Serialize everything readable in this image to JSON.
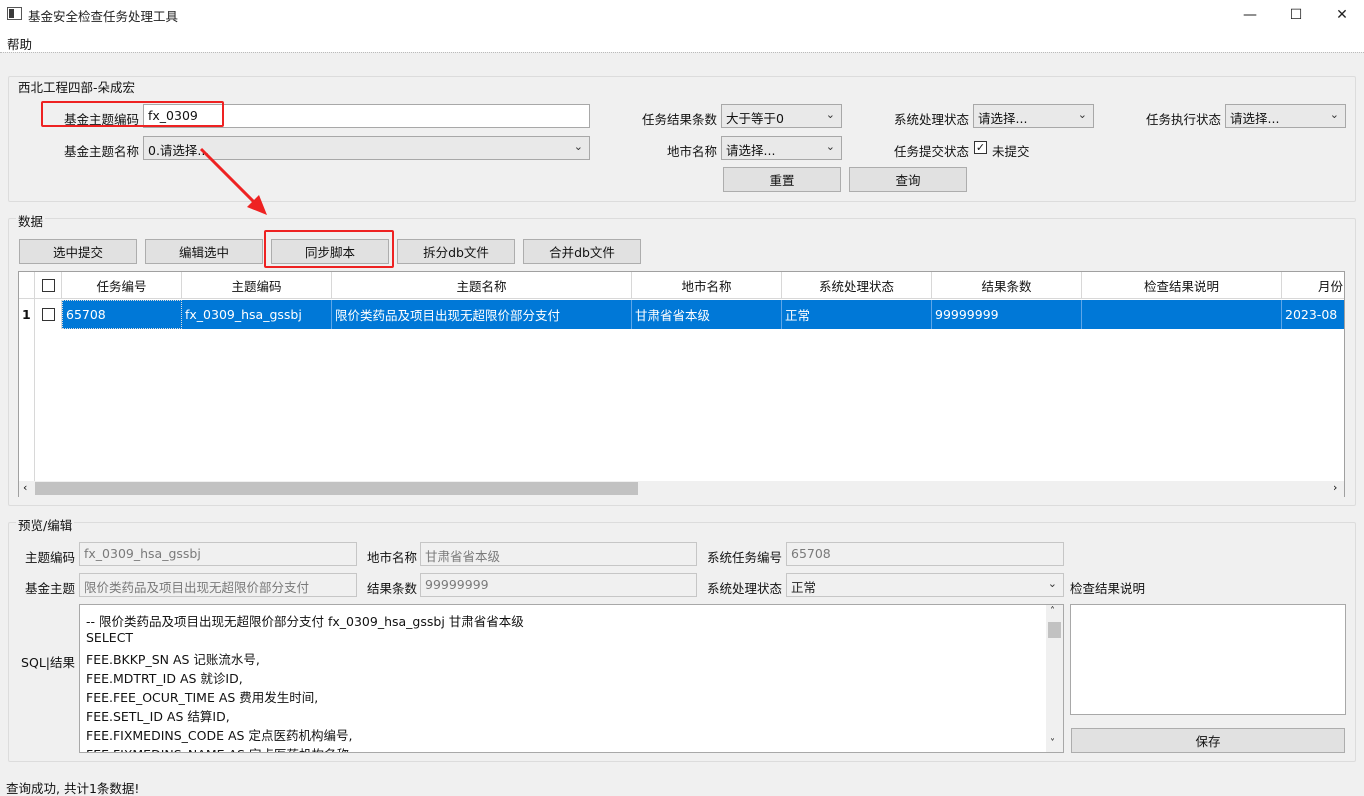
{
  "window": {
    "title": "基金安全检查任务处理工具",
    "minimize_glyph": "—",
    "maximize_glyph": "☐",
    "close_glyph": "✕"
  },
  "menu": {
    "help": "帮助"
  },
  "query_group": {
    "title": "西北工程四部-朵成宏",
    "fund_code_label": "基金主题编码",
    "fund_code_value": "fx_0309",
    "fund_name_label": "基金主题名称",
    "fund_name_value": "0.请选择...",
    "result_count_label": "任务结果条数",
    "result_count_value": "大于等于0",
    "city_label": "地市名称",
    "city_value": "请选择...",
    "sys_status_label": "系统处理状态",
    "sys_status_value": "请选择...",
    "submit_status_label": "任务提交状态",
    "submit_status_check": "✓",
    "submit_status_value": "未提交",
    "exec_status_label": "任务执行状态",
    "exec_status_value": "请选择...",
    "reset_button": "重置",
    "query_button": "查询"
  },
  "data_group": {
    "title": "数据",
    "buttons": {
      "submit_selected": "选中提交",
      "edit_selected": "编辑选中",
      "sync_script": "同步脚本",
      "split_db": "拆分db文件",
      "merge_db": "合并db文件"
    },
    "columns": [
      "任务编号",
      "主题编码",
      "主题名称",
      "地市名称",
      "系统处理状态",
      "结果条数",
      "检查结果说明",
      "月份"
    ],
    "rows": [
      {
        "index": "1",
        "task_no": "65708",
        "theme_code": "fx_0309_hsa_gssbj",
        "theme_name": "限价类药品及项目出现无超限价部分支付",
        "city": "甘肃省省本级",
        "sys_status": "正常",
        "result_count": "99999999",
        "check_note": "",
        "month": "2023-08"
      }
    ]
  },
  "preview_group": {
    "title": "预览/编辑",
    "theme_code_label": "主题编码",
    "theme_code_value": "fx_0309_hsa_gssbj",
    "city_label": "地市名称",
    "city_value": "甘肃省省本级",
    "sys_task_no_label": "系统任务编号",
    "sys_task_no_value": "65708",
    "fund_theme_label": "基金主题",
    "fund_theme_value": "限价类药品及项目出现无超限价部分支付",
    "result_count_label": "结果条数",
    "result_count_value": "99999999",
    "sys_status_label": "系统处理状态",
    "sys_status_value": "正常",
    "check_note_label": "检查结果说明",
    "sql_label": "SQL|结果",
    "sql_lines": [
      "-- 限价类药品及项目出现无超限价部分支付 fx_0309_hsa_gssbj 甘肃省省本级",
      "SELECT",
      "FEE.BKKP_SN AS 记账流水号,",
      "FEE.MDTRT_ID AS 就诊ID,",
      "FEE.FEE_OCUR_TIME AS 费用发生时间,",
      "FEE.SETL_ID AS 结算ID,",
      "FEE.FIXMEDINS_CODE AS 定点医药机构编号,",
      "FEE.FIXMEDINS_NAME AS 定点医药机构名称,"
    ],
    "save_button": "保存"
  },
  "status_bar": "查询成功, 共计1条数据!"
}
